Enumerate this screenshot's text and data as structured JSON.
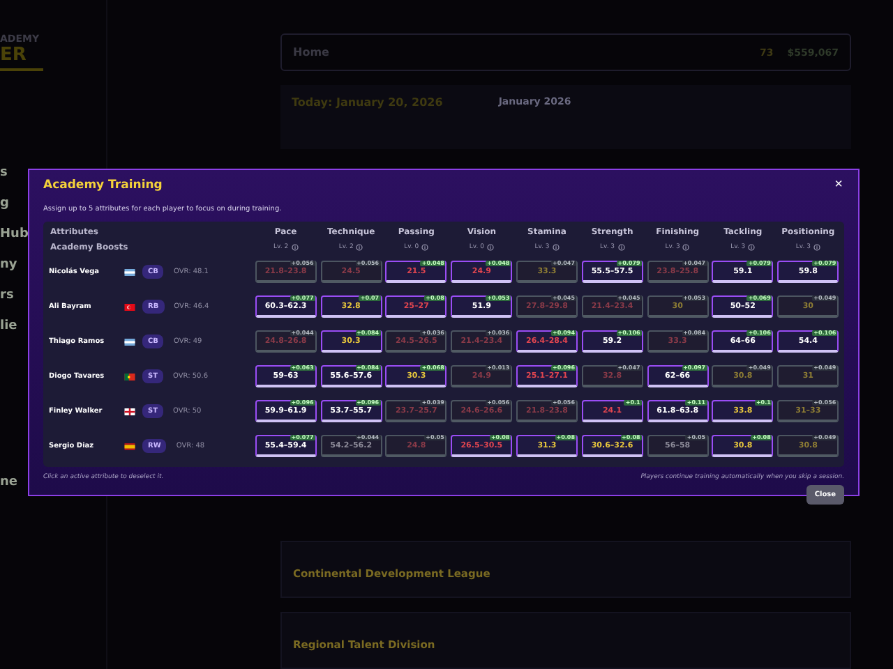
{
  "background": {
    "brand": [
      "ADEMY",
      "ER"
    ],
    "sidebar": [
      "s",
      "g",
      "Hub",
      "ny",
      "rs",
      "lie",
      "ne"
    ],
    "header": {
      "title": "Home",
      "count": "73",
      "money": "$559,067"
    },
    "today": "Today: January 20, 2026",
    "month": "January 2026",
    "leagues": [
      "Continental Development League",
      "Regional Talent Division"
    ]
  },
  "modal": {
    "title": "Academy Training",
    "close": "×",
    "subtitle": "Assign up to 5 attributes for each player to focus on during training.",
    "corner_labels": [
      "Attributes",
      "Academy Boosts"
    ],
    "columns": [
      {
        "name": "Pace",
        "boost": "Lv. 2"
      },
      {
        "name": "Technique",
        "boost": "Lv. 2"
      },
      {
        "name": "Passing",
        "boost": "Lv. 0"
      },
      {
        "name": "Vision",
        "boost": "Lv. 0"
      },
      {
        "name": "Stamina",
        "boost": "Lv. 3"
      },
      {
        "name": "Strength",
        "boost": "Lv. 3"
      },
      {
        "name": "Finishing",
        "boost": "Lv. 3"
      },
      {
        "name": "Tackling",
        "boost": "Lv. 3"
      },
      {
        "name": "Positioning",
        "boost": "Lv. 3"
      }
    ],
    "players": [
      {
        "name": "Nicolás Vega",
        "flag": {
          "kind": "ar"
        },
        "position": "CB",
        "ovr": "OVR: 48.1",
        "cells": [
          {
            "value": "21.8–23.8",
            "delta": "+0.056",
            "kind": "low",
            "selected": false
          },
          {
            "value": "24.5",
            "delta": "+0.056",
            "kind": "low",
            "selected": false
          },
          {
            "value": "21.5",
            "delta": "+0.048",
            "kind": "low",
            "selected": true
          },
          {
            "value": "24.9",
            "delta": "+0.048",
            "kind": "low",
            "selected": true
          },
          {
            "value": "33.3",
            "delta": "+0.047",
            "kind": "mid",
            "selected": false
          },
          {
            "value": "55.5–57.5",
            "delta": "+0.079",
            "kind": "high",
            "selected": true
          },
          {
            "value": "23.8–25.8",
            "delta": "+0.047",
            "kind": "low",
            "selected": false
          },
          {
            "value": "59.1",
            "delta": "+0.079",
            "kind": "high",
            "selected": true
          },
          {
            "value": "59.8",
            "delta": "+0.079",
            "kind": "high",
            "selected": true
          }
        ]
      },
      {
        "name": "Ali Bayram",
        "flag": {
          "kind": "tr"
        },
        "position": "RB",
        "ovr": "OVR: 46.4",
        "cells": [
          {
            "value": "60.3–62.3",
            "delta": "+0.077",
            "kind": "high",
            "selected": true
          },
          {
            "value": "32.8",
            "delta": "+0.07",
            "kind": "mid",
            "selected": true
          },
          {
            "value": "25–27",
            "delta": "+0.08",
            "kind": "low",
            "selected": true
          },
          {
            "value": "51.9",
            "delta": "+0.053",
            "kind": "high",
            "selected": true
          },
          {
            "value": "27.8–29.8",
            "delta": "+0.045",
            "kind": "low",
            "selected": false
          },
          {
            "value": "21.4–23.4",
            "delta": "+0.045",
            "kind": "low",
            "selected": false
          },
          {
            "value": "30",
            "delta": "+0.053",
            "kind": "mid",
            "selected": false
          },
          {
            "value": "50–52",
            "delta": "+0.069",
            "kind": "high",
            "selected": true
          },
          {
            "value": "30",
            "delta": "+0.049",
            "kind": "mid",
            "selected": false
          }
        ]
      },
      {
        "name": "Thiago Ramos",
        "flag": {
          "kind": "ar"
        },
        "position": "CB",
        "ovr": "OVR: 49",
        "cells": [
          {
            "value": "24.8–26.8",
            "delta": "+0.044",
            "kind": "low",
            "selected": false
          },
          {
            "value": "30.3",
            "delta": "+0.084",
            "kind": "mid",
            "selected": true
          },
          {
            "value": "24.5–26.5",
            "delta": "+0.036",
            "kind": "low",
            "selected": false
          },
          {
            "value": "21.4–23.4",
            "delta": "+0.036",
            "kind": "low",
            "selected": false
          },
          {
            "value": "26.4–28.4",
            "delta": "+0.094",
            "kind": "low",
            "selected": true
          },
          {
            "value": "59.2",
            "delta": "+0.106",
            "kind": "high",
            "selected": true
          },
          {
            "value": "33.3",
            "delta": "+0.084",
            "kind": "low",
            "selected": false
          },
          {
            "value": "64–66",
            "delta": "+0.106",
            "kind": "high",
            "selected": true
          },
          {
            "value": "54.4",
            "delta": "+0.106",
            "kind": "high",
            "selected": true
          }
        ]
      },
      {
        "name": "Diogo Tavares",
        "flag": {
          "kind": "pt"
        },
        "position": "ST",
        "ovr": "OVR: 50.6",
        "cells": [
          {
            "value": "59–63",
            "delta": "+0.063",
            "kind": "high",
            "selected": true
          },
          {
            "value": "55.6–57.6",
            "delta": "+0.084",
            "kind": "high",
            "selected": true
          },
          {
            "value": "30.3",
            "delta": "+0.068",
            "kind": "mid",
            "selected": true
          },
          {
            "value": "24.9",
            "delta": "+0.013",
            "kind": "low",
            "selected": false
          },
          {
            "value": "25.1–27.1",
            "delta": "+0.096",
            "kind": "low",
            "selected": true
          },
          {
            "value": "32.8",
            "delta": "+0.047",
            "kind": "low",
            "selected": false
          },
          {
            "value": "62–66",
            "delta": "+0.097",
            "kind": "high",
            "selected": true
          },
          {
            "value": "30.8",
            "delta": "+0.049",
            "kind": "mid",
            "selected": false
          },
          {
            "value": "31",
            "delta": "+0.049",
            "kind": "mid",
            "selected": false
          }
        ]
      },
      {
        "name": "Finley Walker",
        "flag": {
          "kind": "en"
        },
        "position": "ST",
        "ovr": "OVR: 50",
        "cells": [
          {
            "value": "59.9–61.9",
            "delta": "+0.096",
            "kind": "high",
            "selected": true
          },
          {
            "value": "53.7–55.7",
            "delta": "+0.096",
            "kind": "high",
            "selected": true
          },
          {
            "value": "23.7–25.7",
            "delta": "+0.039",
            "kind": "low",
            "selected": false
          },
          {
            "value": "24.6–26.6",
            "delta": "+0.056",
            "kind": "low",
            "selected": false
          },
          {
            "value": "21.8–23.8",
            "delta": "+0.056",
            "kind": "low",
            "selected": false
          },
          {
            "value": "24.1",
            "delta": "+0.1",
            "kind": "low",
            "selected": true
          },
          {
            "value": "61.8–63.8",
            "delta": "+0.11",
            "kind": "high",
            "selected": true
          },
          {
            "value": "33.8",
            "delta": "+0.1",
            "kind": "mid",
            "selected": true
          },
          {
            "value": "31–33",
            "delta": "+0.056",
            "kind": "mid",
            "selected": false
          }
        ]
      },
      {
        "name": "Sergio Diaz",
        "flag": {
          "kind": "es"
        },
        "position": "RW",
        "ovr": "OVR: 48",
        "cells": [
          {
            "value": "55.4–59.4",
            "delta": "+0.077",
            "kind": "high",
            "selected": true
          },
          {
            "value": "54.2–56.2",
            "delta": "+0.044",
            "kind": "high",
            "selected": false
          },
          {
            "value": "24.8",
            "delta": "+0.05",
            "kind": "low",
            "selected": false
          },
          {
            "value": "26.5–30.5",
            "delta": "+0.08",
            "kind": "low",
            "selected": true
          },
          {
            "value": "31.3",
            "delta": "+0.08",
            "kind": "mid",
            "selected": true
          },
          {
            "value": "30.6–32.6",
            "delta": "+0.08",
            "kind": "mid",
            "selected": true
          },
          {
            "value": "56–58",
            "delta": "+0.05",
            "kind": "high",
            "selected": false
          },
          {
            "value": "30.8",
            "delta": "+0.08",
            "kind": "mid",
            "selected": true
          },
          {
            "value": "30.8",
            "delta": "+0.049",
            "kind": "mid",
            "selected": false
          }
        ]
      }
    ],
    "hint_left": "Click an active attribute to deselect it.",
    "hint_right": "Players continue training automatically when you skip a session.",
    "close_button": "Close"
  }
}
